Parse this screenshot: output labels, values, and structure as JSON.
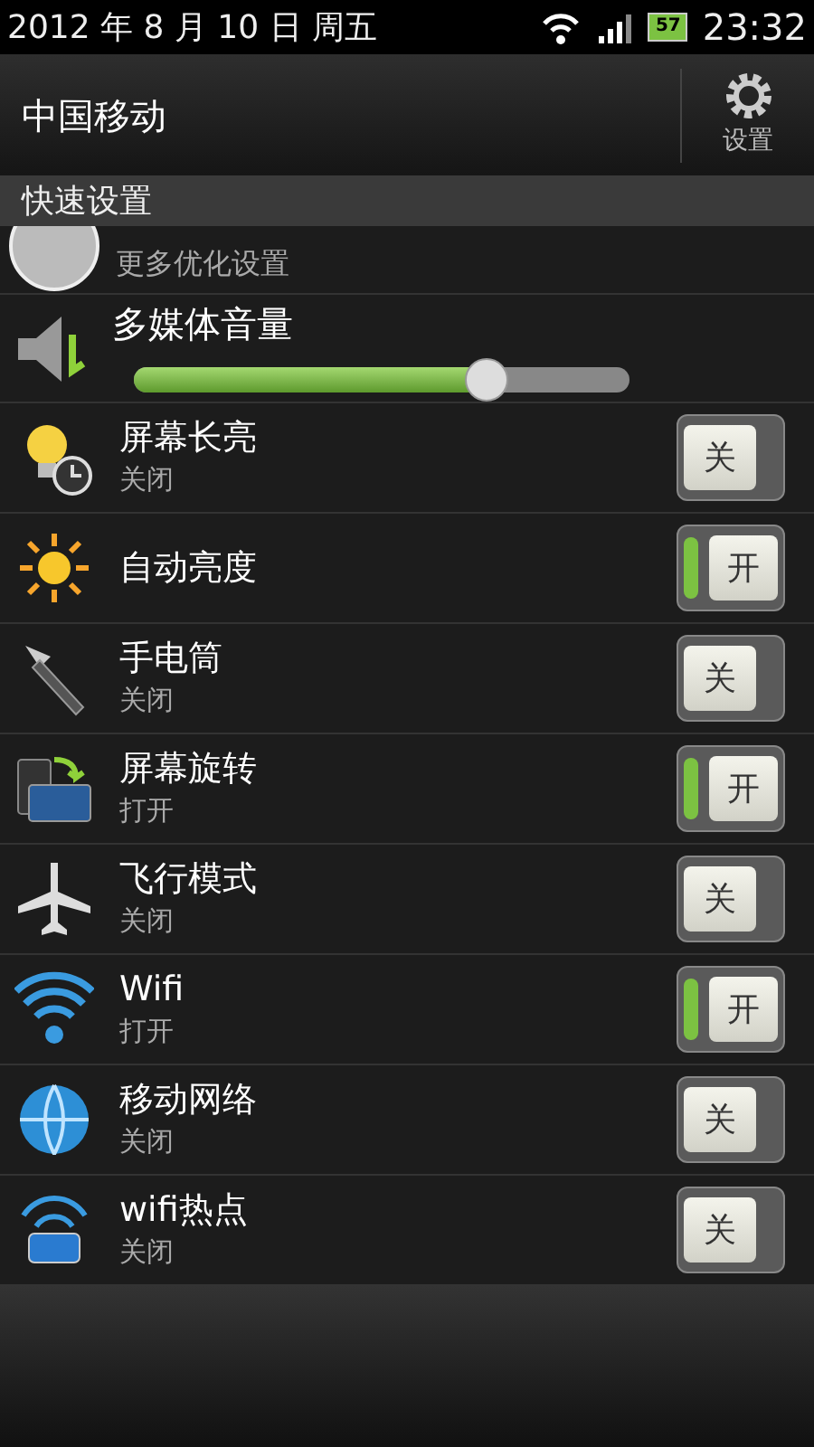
{
  "status_bar": {
    "date": "2012 年 8 月 10 日 周五",
    "battery": "57",
    "time": "23:32"
  },
  "header": {
    "carrier": "中国移动",
    "settings_label": "设置"
  },
  "section": {
    "title": "快速设置"
  },
  "partial_row": {
    "subtitle": "更多优化设置"
  },
  "volume": {
    "title": "多媒体音量",
    "level": 0.71
  },
  "toggles": [
    {
      "kind": "bulb",
      "title": "屏幕长亮",
      "status": "关闭",
      "on": false,
      "switch_label": "关"
    },
    {
      "kind": "sun",
      "title": "自动亮度",
      "on": true,
      "switch_label": "开"
    },
    {
      "kind": "torch",
      "title": "手电筒",
      "status": "关闭",
      "on": false,
      "switch_label": "关"
    },
    {
      "kind": "rotate",
      "title": "屏幕旋转",
      "status": "打开",
      "on": true,
      "switch_label": "开"
    },
    {
      "kind": "plane",
      "title": "飞行模式",
      "status": "关闭",
      "on": false,
      "switch_label": "关"
    },
    {
      "kind": "wifi",
      "title": "Wifi",
      "status": "打开",
      "on": true,
      "switch_label": "开"
    },
    {
      "kind": "globe",
      "title": "移动网络",
      "status": "关闭",
      "on": false,
      "switch_label": "关"
    },
    {
      "kind": "hotspot",
      "title": "wifi热点",
      "status": "关闭",
      "on": false,
      "switch_label": "关"
    }
  ]
}
